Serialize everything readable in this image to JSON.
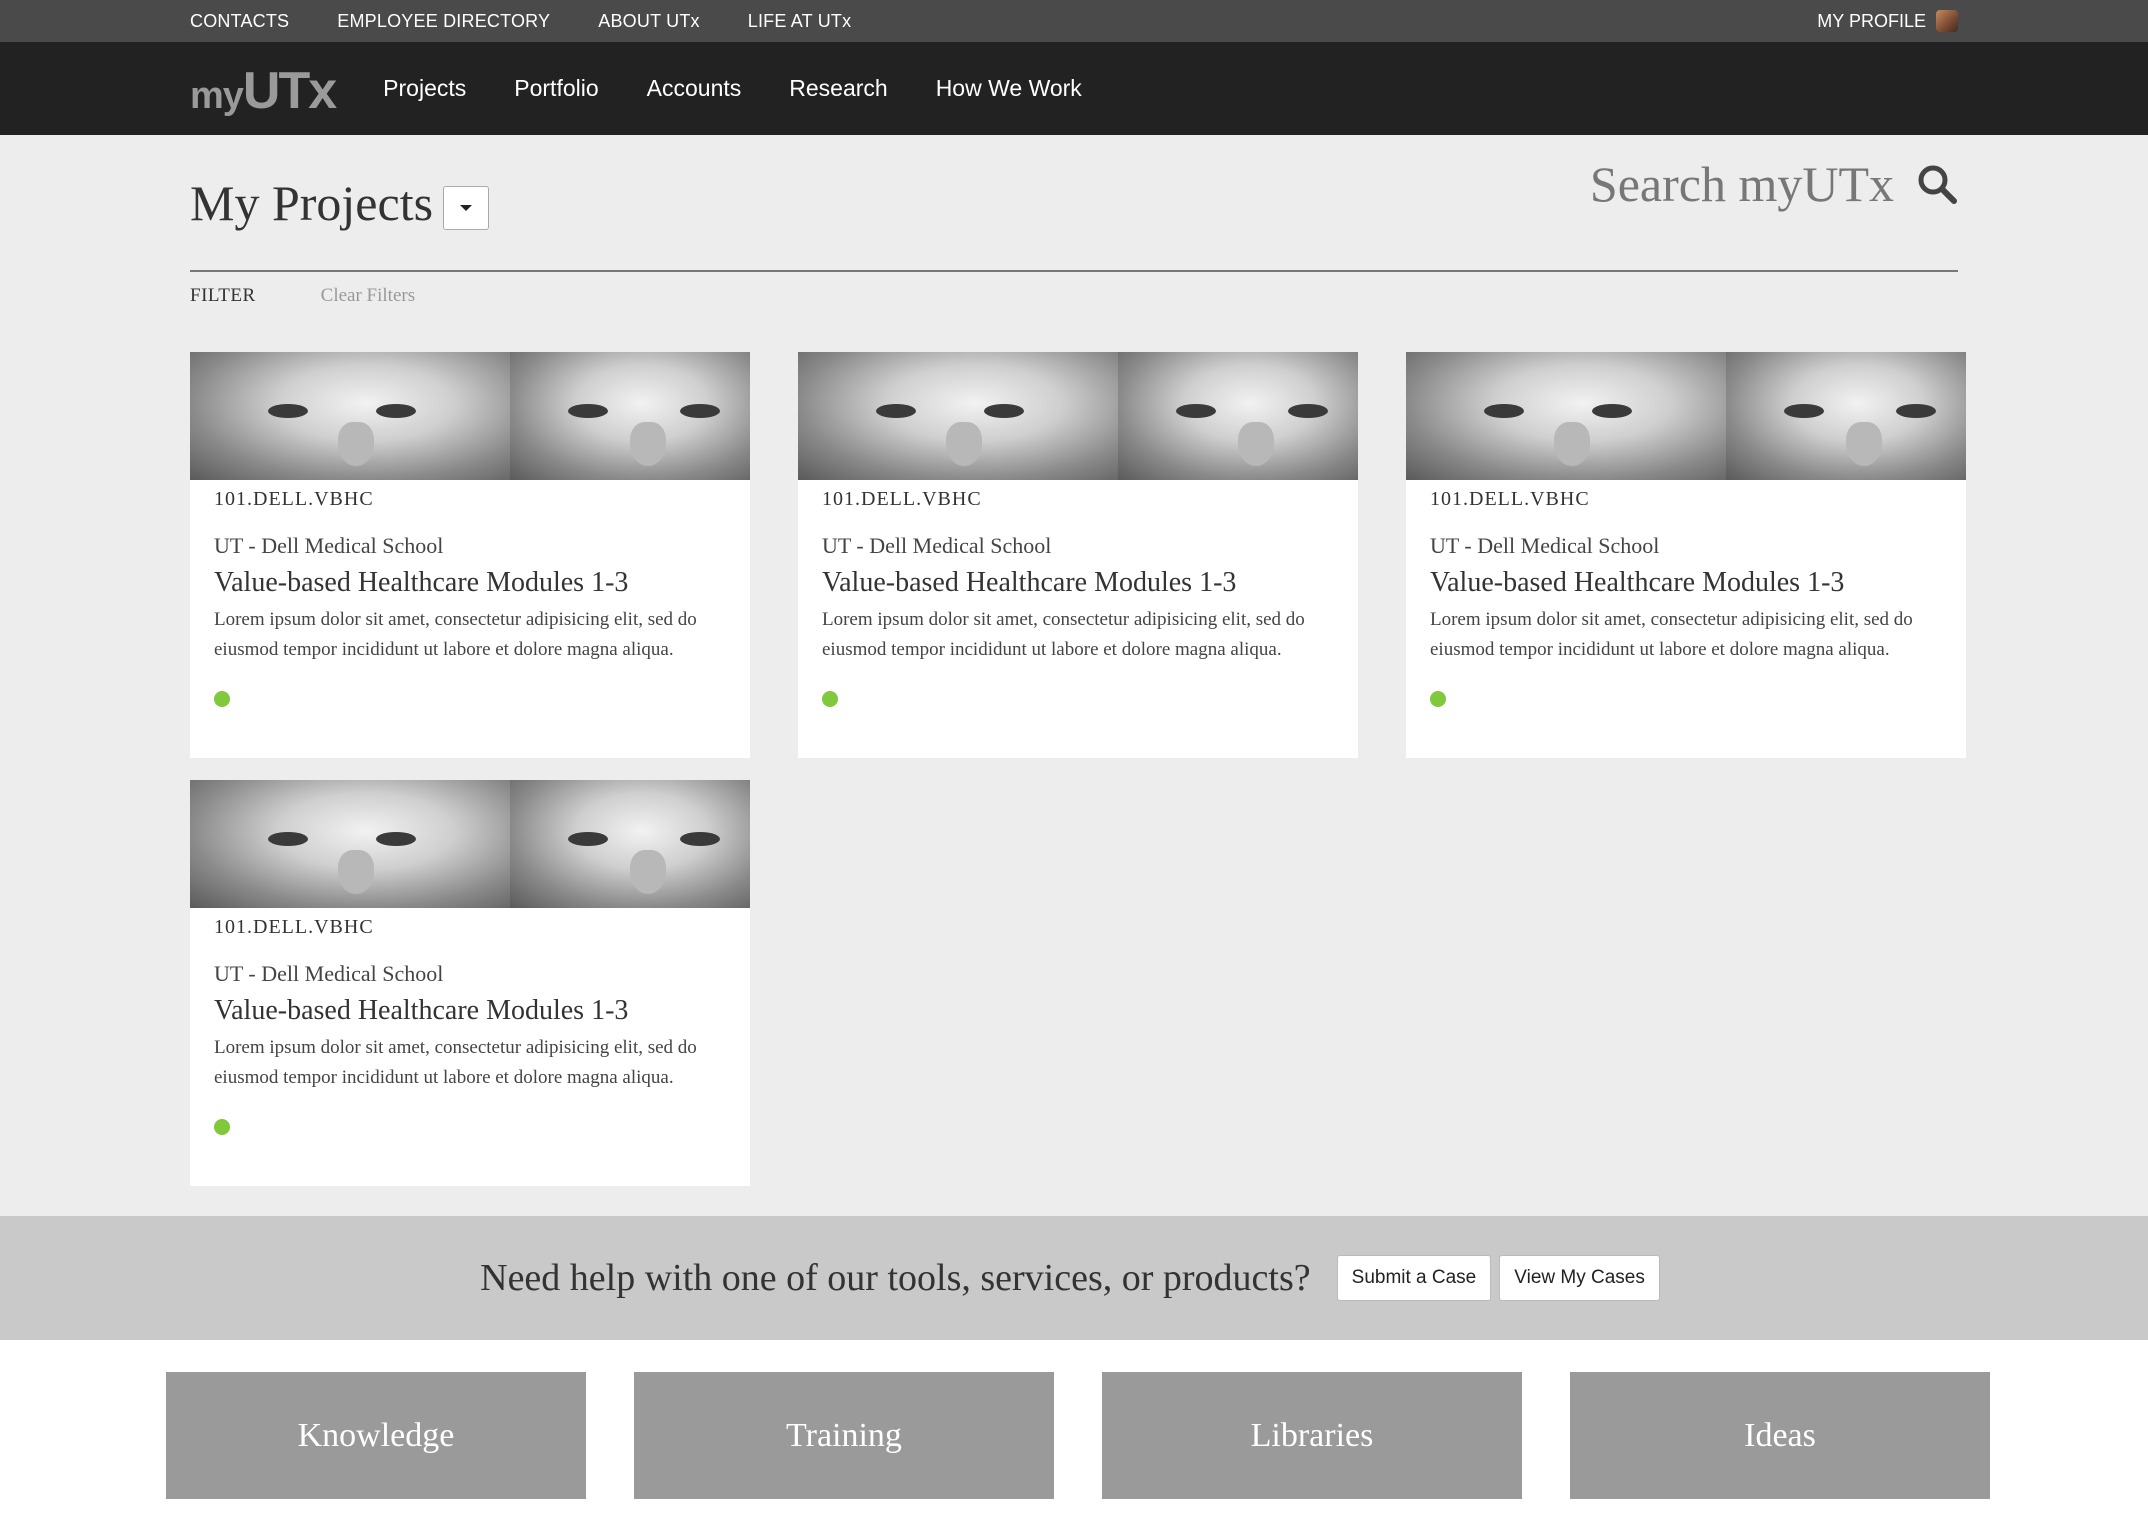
{
  "utility_nav": {
    "links": [
      "CONTACTS",
      "EMPLOYEE DIRECTORY",
      "ABOUT UTx",
      "LIFE AT UTx"
    ],
    "profile_label": "MY PROFILE"
  },
  "main_nav": {
    "logo_my": "my",
    "logo_utx": "UTx",
    "links": [
      "Projects",
      "Portfolio",
      "Accounts",
      "Research",
      "How We Work"
    ]
  },
  "page": {
    "title": "My Projects",
    "search_label": "Search myUTx"
  },
  "filter": {
    "label": "FILTER",
    "clear_label": "Clear Filters"
  },
  "cards": [
    {
      "code": "101.DELL.VBHC",
      "school": "UT - Dell Medical School",
      "title": "Value-based Healthcare Modules 1-3",
      "description": "Lorem ipsum dolor sit amet, consectetur adipisicing elit, sed do eiusmod tempor incididunt ut labore et dolore magna aliqua.",
      "status_color": "#7fc93a"
    },
    {
      "code": "101.DELL.VBHC",
      "school": "UT - Dell Medical School",
      "title": "Value-based Healthcare Modules 1-3",
      "description": "Lorem ipsum dolor sit amet, consectetur adipisicing elit, sed do eiusmod tempor incididunt ut labore et dolore magna aliqua.",
      "status_color": "#7fc93a"
    },
    {
      "code": "101.DELL.VBHC",
      "school": "UT - Dell Medical School",
      "title": "Value-based Healthcare Modules 1-3",
      "description": "Lorem ipsum dolor sit amet, consectetur adipisicing elit, sed do eiusmod tempor incididunt ut labore et dolore magna aliqua.",
      "status_color": "#7fc93a"
    },
    {
      "code": "101.DELL.VBHC",
      "school": "UT - Dell Medical School",
      "title": "Value-based Healthcare Modules 1-3",
      "description": "Lorem ipsum dolor sit amet, consectetur adipisicing elit, sed do eiusmod tempor incididunt ut labore et dolore magna aliqua.",
      "status_color": "#7fc93a"
    }
  ],
  "help": {
    "text": "Need help with one of our tools, services, or products?",
    "submit_label": "Submit a Case",
    "view_label": "View My Cases"
  },
  "tiles": [
    "Knowledge",
    "Training",
    "Libraries",
    "Ideas"
  ],
  "colors": {
    "utility_bar": "#4a4a4a",
    "main_nav": "#222222",
    "status_active": "#7fc93a",
    "tile": "#9a9a9a"
  }
}
